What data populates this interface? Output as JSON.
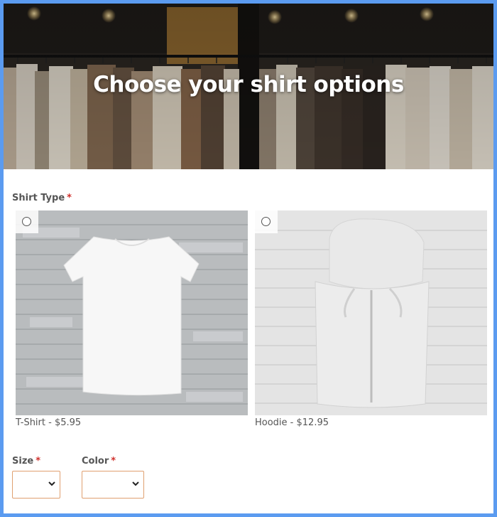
{
  "header": {
    "title": "Choose your shirt options"
  },
  "shirt_type": {
    "label": "Shirt Type",
    "required_mark": "*",
    "options": [
      {
        "caption": "T-Shirt - $5.95",
        "image": "white t-shirt on wood planks",
        "selected": false
      },
      {
        "caption": "Hoodie - $12.95",
        "image": "folded grey hoodie on wood planks",
        "selected": false
      }
    ]
  },
  "size": {
    "label": "Size",
    "required_mark": "*",
    "selected_value": ""
  },
  "color": {
    "label": "Color",
    "required_mark": "*",
    "selected_value": ""
  },
  "colors": {
    "frame_border": "#5b9bf0",
    "required": "#d0312d",
    "select_border": "#e0a070",
    "label_text": "#555555"
  }
}
